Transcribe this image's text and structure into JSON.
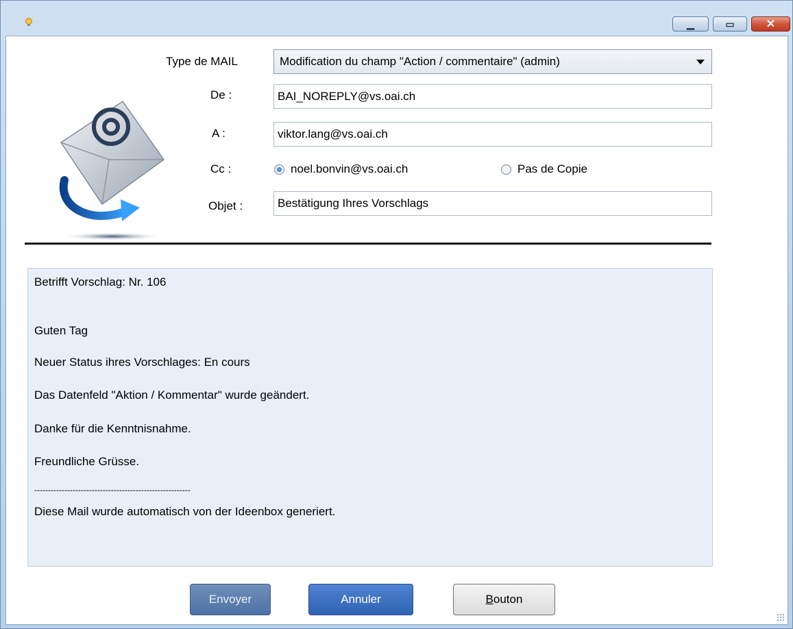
{
  "window": {
    "title": ""
  },
  "form": {
    "type_label": "Type de MAIL",
    "type_value": "Modification du champ \"Action / commentaire\" (admin)",
    "from_label": "De :",
    "from_value": "BAI_NOREPLY@vs.oai.ch",
    "to_label": "A :",
    "to_value": "viktor.lang@vs.oai.ch",
    "cc_label": "Cc :",
    "cc_option_1": "noel.bonvin@vs.oai.ch",
    "cc_option_2": "Pas de Copie",
    "subject_label": "Objet :",
    "subject_value": "Bestätigung Ihres Vorschlags"
  },
  "message": {
    "lines": [
      "Betrifft Vorschlag: Nr. 106",
      "Guten Tag",
      "Neuer Status ihres Vorschlages: En cours",
      "Das Datenfeld \"Aktion / Kommentar\" wurde geändert.",
      "Danke für die Kenntnisnahme.",
      "Freundliche Grüsse.",
      "---------------------------------------------------------",
      "Diese Mail wurde automatisch von der Ideenbox generiert."
    ]
  },
  "buttons": {
    "send": "Envoyer",
    "cancel": "Annuler",
    "other_prefix": "B",
    "other_rest": "outon"
  },
  "colors": {
    "accent": "#2f63b5",
    "body_bg": "#e8eff8"
  }
}
